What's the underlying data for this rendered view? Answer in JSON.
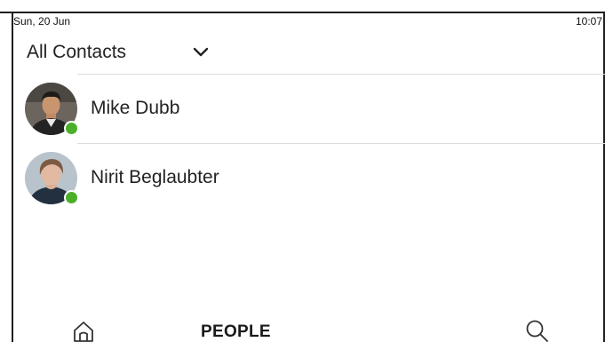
{
  "status_bar": {
    "date": "Sun, 20 Jun",
    "time": "10:07"
  },
  "filter": {
    "selected": "All Contacts",
    "icon": "chevron-down-icon"
  },
  "contacts": [
    {
      "name": "Mike Dubb",
      "presence": "available",
      "presence_color": "#4caf2a"
    },
    {
      "name": "Nirit Beglaubter",
      "presence": "available",
      "presence_color": "#4caf2a"
    }
  ],
  "bottom_nav": {
    "home_icon": "home-icon",
    "active_tab": "PEOPLE",
    "search_icon": "search-icon"
  }
}
